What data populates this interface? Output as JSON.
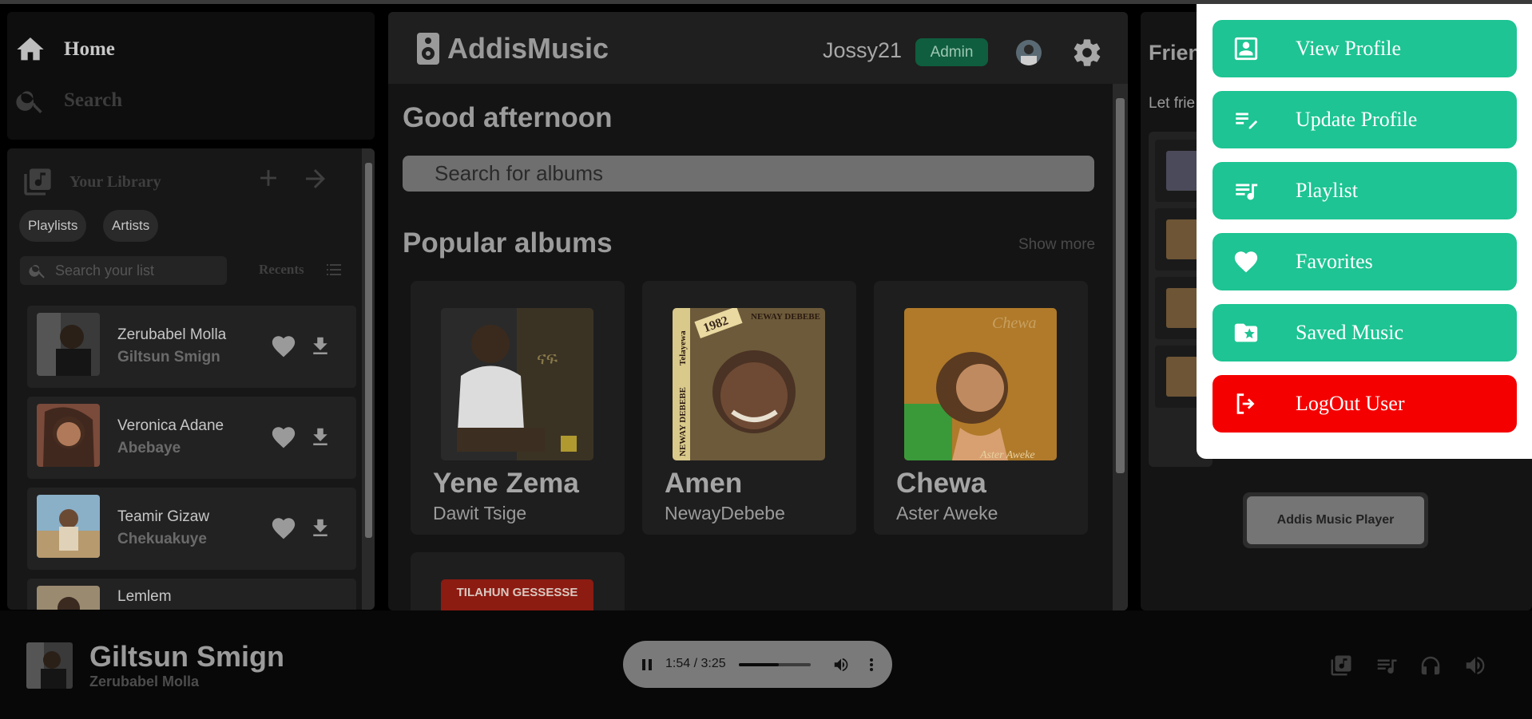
{
  "nav": {
    "home": "Home",
    "search": "Search"
  },
  "library": {
    "title": "Your Library",
    "chips": [
      "Playlists",
      "Artists"
    ],
    "search_placeholder": "Search your list",
    "recents": "Recents",
    "songs": [
      {
        "artist": "Zerubabel Molla",
        "title": "Giltsun Smign"
      },
      {
        "artist": "Veronica Adane",
        "title": "Abebaye"
      },
      {
        "artist": "Teamir Gizaw",
        "title": "Chekuakuye"
      },
      {
        "artist": "Lemlem",
        "title": ""
      }
    ]
  },
  "header": {
    "brand": "AddisMusic",
    "username": "Jossy21",
    "role_badge": "Admin"
  },
  "main": {
    "greeting": "Good afternoon",
    "album_search_placeholder": "Search for albums",
    "popular_heading": "Popular albums",
    "show_more": "Show more",
    "albums": [
      {
        "title": "Yene Zema",
        "artist": "Dawit Tsige"
      },
      {
        "title": "Amen",
        "artist": "NewayDebebe"
      },
      {
        "title": "Chewa",
        "artist": "Aster Aweke"
      }
    ],
    "album4_cover_text": "TILAHUN GESSESSE",
    "cover_texts": {
      "amen_year": "1982",
      "amen_top": "NEWAY DEBEBE",
      "amen_side1": "NEWAY DEBEBE",
      "amen_side2": "Telayewa",
      "chewa_script": "Chewa",
      "chewa_name": "Aster Aweke"
    }
  },
  "friends": {
    "title": "Frien",
    "subtitle": "Let frie",
    "player_button": "Addis Music Player"
  },
  "menu": {
    "items": [
      {
        "label": "View Profile",
        "icon": "profile-card-icon"
      },
      {
        "label": "Update Profile",
        "icon": "edit-list-icon"
      },
      {
        "label": "Playlist",
        "icon": "playlist-icon"
      },
      {
        "label": "Favorites",
        "icon": "heart-icon"
      },
      {
        "label": "Saved Music",
        "icon": "star-folder-icon"
      },
      {
        "label": "LogOut User",
        "icon": "logout-icon"
      }
    ]
  },
  "player": {
    "title": "Giltsun Smign",
    "artist": "Zerubabel Molla",
    "time": "1:54 / 3:25",
    "progress": 0.56
  },
  "colors": {
    "accent_green": "#1ec493",
    "logout_red": "#f50000",
    "admin_badge": "#0f5e3f"
  }
}
